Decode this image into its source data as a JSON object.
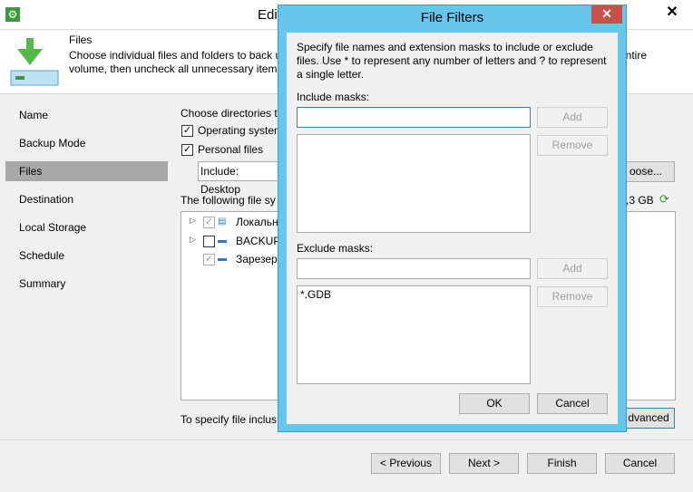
{
  "main": {
    "title": "Edi",
    "app_icon": "gear-icon",
    "close_glyph": "✕",
    "header": {
      "title": "Files",
      "description": "Choose individual files and folders to back u",
      "description_line2": "volume, then uncheck all unnecessary items",
      "description_right": "entire"
    },
    "nav": [
      "Name",
      "Backup Mode",
      "Files",
      "Destination",
      "Local Storage",
      "Schedule",
      "Summary"
    ],
    "choose_dirs_label": "Choose directories to",
    "os_label": "Operating system",
    "personal_label": "Personal files",
    "include_field": "Include: Desktop",
    "choose_btn": "oose...",
    "following_label": "The following file sy",
    "size_label": ",3 GB",
    "tree_items": [
      "Локальн",
      "BACKUP",
      "Зарезерв"
    ],
    "specify_label": "To specify file inclus",
    "advanced_btn": "dvanced",
    "buttons": {
      "previous": "< Previous",
      "next": "Next >",
      "finish": "Finish",
      "cancel": "Cancel"
    }
  },
  "dialog": {
    "title": "File Filters",
    "close_glyph": "✕",
    "description": "Specify file names and extension masks to include or exclude files. Use * to represent any number of letters and ? to represent a single letter.",
    "include_label": "Include masks:",
    "include_value": "",
    "include_list": [],
    "exclude_label": "Exclude masks:",
    "exclude_value": "",
    "exclude_list": [
      "*.GDB"
    ],
    "add_label": "Add",
    "remove_label": "Remove",
    "ok_label": "OK",
    "cancel_label": "Cancel"
  }
}
